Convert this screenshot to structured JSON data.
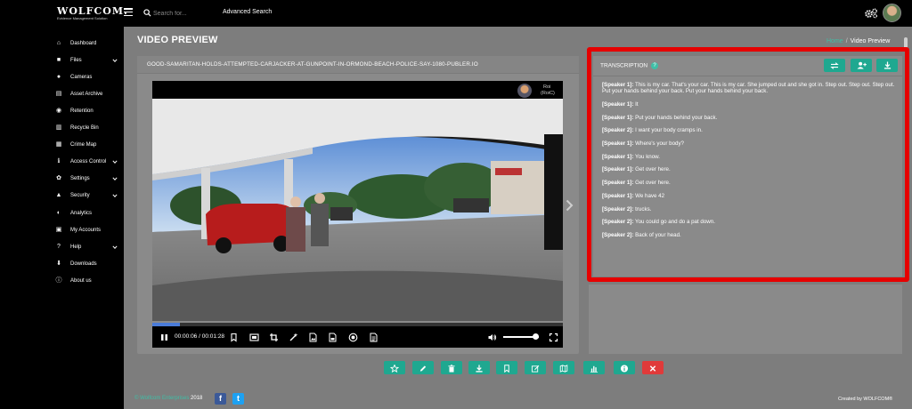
{
  "app": {
    "logo_main": "WOLFCOM.",
    "logo_sub": "Evidence Management Solution",
    "search_placeholder": "Search for...",
    "advanced_search": "Advanced Search"
  },
  "sidebar": {
    "items": [
      {
        "label": "Dashboard",
        "icon": "home-icon",
        "has_submenu": false
      },
      {
        "label": "Files",
        "icon": "folder-icon",
        "has_submenu": true
      },
      {
        "label": "Cameras",
        "icon": "camera-icon",
        "has_submenu": false
      },
      {
        "label": "Asset Archive",
        "icon": "archive-icon",
        "has_submenu": false
      },
      {
        "label": "Retention",
        "icon": "retention-icon",
        "has_submenu": false
      },
      {
        "label": "Recycle Bin",
        "icon": "trash-icon",
        "has_submenu": false
      },
      {
        "label": "Crime Map",
        "icon": "map-icon",
        "has_submenu": false
      },
      {
        "label": "Access Control",
        "icon": "info-icon",
        "has_submenu": true
      },
      {
        "label": "Settings",
        "icon": "gear-icon",
        "has_submenu": true
      },
      {
        "label": "Security",
        "icon": "lock-icon",
        "has_submenu": true
      },
      {
        "label": "Analytics",
        "icon": "analytics-icon",
        "has_submenu": false
      },
      {
        "label": "My Accounts",
        "icon": "user-icon",
        "has_submenu": false
      },
      {
        "label": "Help",
        "icon": "help-icon",
        "has_submenu": true
      },
      {
        "label": "Downloads",
        "icon": "download-icon",
        "has_submenu": false
      },
      {
        "label": "About us",
        "icon": "about-icon",
        "has_submenu": false
      }
    ]
  },
  "page": {
    "title": "VIDEO PREVIEW",
    "breadcrumb_home": "Home",
    "breadcrumb_sep": "/",
    "breadcrumb_current": "Video Preview"
  },
  "video": {
    "filename": "GOOD-SAMARITAN-HOLDS-ATTEMPTED-CARJACKER-AT-GUNPOINT-IN-ORMOND-BEACH-POLICE-SAY-1080-PUBLER.IO",
    "channel_name": "Roi",
    "channel_handle": "(RoiC)",
    "time": "00:00:06 / 00:01:28",
    "progress": 0.068,
    "volume": 0.9
  },
  "transcription": {
    "header": "TRANSCRIPTION",
    "lines": [
      {
        "speaker": "[Speaker 1]:",
        "text": "This is my car. That's your car. This is my car. She jumped out and she got in. Step out. Step out. Step out. Put your hands behind your back. Put your hands behind your back."
      },
      {
        "speaker": "[Speaker 1]:",
        "text": "It"
      },
      {
        "speaker": "[Speaker 1]:",
        "text": "Put your hands behind your back."
      },
      {
        "speaker": "[Speaker 2]:",
        "text": "I want your body cramps in."
      },
      {
        "speaker": "[Speaker 1]:",
        "text": "Where's your body?"
      },
      {
        "speaker": "[Speaker 1]:",
        "text": "You know."
      },
      {
        "speaker": "[Speaker 1]:",
        "text": "Get over here."
      },
      {
        "speaker": "[Speaker 1]:",
        "text": "Get over here."
      },
      {
        "speaker": "[Speaker 1]:",
        "text": "We have 42"
      },
      {
        "speaker": "[Speaker 2]:",
        "text": "trucks."
      },
      {
        "speaker": "[Speaker 2]:",
        "text": "You could go and do a pat down."
      },
      {
        "speaker": "[Speaker 2]:",
        "text": "Back of your head."
      }
    ]
  },
  "actions": [
    "star-icon",
    "pencil-icon",
    "delete-icon",
    "download-icon",
    "bookmark-icon",
    "edit-icon",
    "map-icon",
    "chart-icon",
    "info-icon",
    "close-icon"
  ],
  "footer": {
    "copyright_symbol": "©",
    "brand": "Wolfcom Enterprises",
    "year": "2018",
    "facebook": "f",
    "twitter": "t",
    "credit": "Created by WOLFCOM®"
  },
  "colors": {
    "accent": "#1fa890",
    "link": "#3fbfa7",
    "highlight_border": "#e60000",
    "danger": "#e03a3a"
  }
}
